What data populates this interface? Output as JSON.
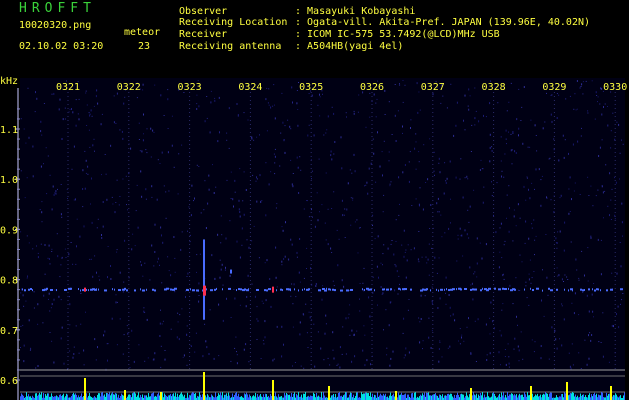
{
  "header": {
    "title": "HROFFT",
    "filename": "10020320.png",
    "datetime": "02.10.02 03:20",
    "meteor_label": "meteor",
    "meteor_count": "23"
  },
  "station": [
    {
      "label": "Observer",
      "value": ": Masayuki Kobayashi"
    },
    {
      "label": "Receiving Location",
      "value": ": Ogata-vill. Akita-Pref. JAPAN (139.96E, 40.02N)"
    },
    {
      "label": "Receiver",
      "value": ": ICOM IC-575 53.7492(@LCD)MHz USB"
    },
    {
      "label": "Receiving antenna",
      "value": ": A504HB(yagi 4el)"
    }
  ],
  "plot": {
    "y_unit": "kHz",
    "y_ticks": [
      "1.1",
      "1.0",
      "0.9",
      "0.8",
      "0.7",
      "0.6"
    ],
    "time_ticks": [
      "0321",
      "0322",
      "0323",
      "0324",
      "0325",
      "0326",
      "0327",
      "0328",
      "0329",
      "0330"
    ],
    "colors": {
      "background": "#000014",
      "text": "#ffff40",
      "title": "#3ad23a",
      "signal": "#4a6cff",
      "peak": "#ff3050",
      "amplitude": "#ffff00",
      "amplitude_alt": "#00e0e0"
    }
  }
}
